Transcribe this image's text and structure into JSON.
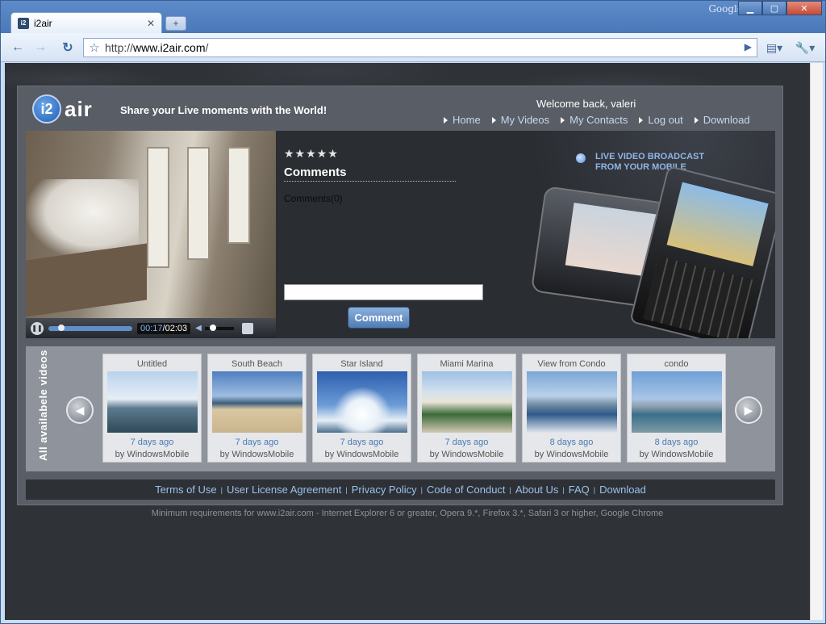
{
  "browser": {
    "tab_title": "i2air",
    "tab_favicon": "i2",
    "google_label": "Google",
    "url_prefix": "http://",
    "url_host": "www.i2air.com",
    "url_suffix": "/"
  },
  "site": {
    "logo_i2": "i2",
    "logo_air": "air",
    "tagline": "Share your Live moments with the World!",
    "welcome": "Welcome back, valeri",
    "nav": [
      "Home",
      "My Videos",
      "My Contacts",
      "Log out",
      "Download"
    ]
  },
  "player": {
    "current_time": "00:17",
    "total_time": "02:03",
    "progress": 0.14
  },
  "comments": {
    "stars": "★★★★★",
    "title": "Comments",
    "count_text": "Comments(0)",
    "button_label": "Comment"
  },
  "promo": {
    "line1": "LIVE VIDEO BROADCAST",
    "line2": "FROM YOUR MOBILE"
  },
  "gallery": {
    "label": "All availabele videos",
    "items": [
      {
        "title": "Untitled",
        "age": "7 days ago",
        "by": "by WindowsMobile"
      },
      {
        "title": "South Beach",
        "age": "7 days ago",
        "by": "by WindowsMobile"
      },
      {
        "title": "Star Island",
        "age": "7 days ago",
        "by": "by WindowsMobile"
      },
      {
        "title": "Miami Marina",
        "age": "7 days ago",
        "by": "by WindowsMobile"
      },
      {
        "title": "View  from Condo",
        "age": "8 days ago",
        "by": "by WindowsMobile"
      },
      {
        "title": "condo",
        "age": "8 days ago",
        "by": "by WindowsMobile"
      }
    ]
  },
  "footer": {
    "links": [
      "Terms of Use",
      "User License Agreement",
      "Privacy Policy",
      "Code of Conduct",
      "About Us",
      "FAQ",
      "Download"
    ],
    "requirements": "Minimum requirements for www.i2air.com - Internet Explorer 6 or greater, Opera 9.*, Firefox 3.*, Safari 3 or higher, Google Chrome"
  }
}
